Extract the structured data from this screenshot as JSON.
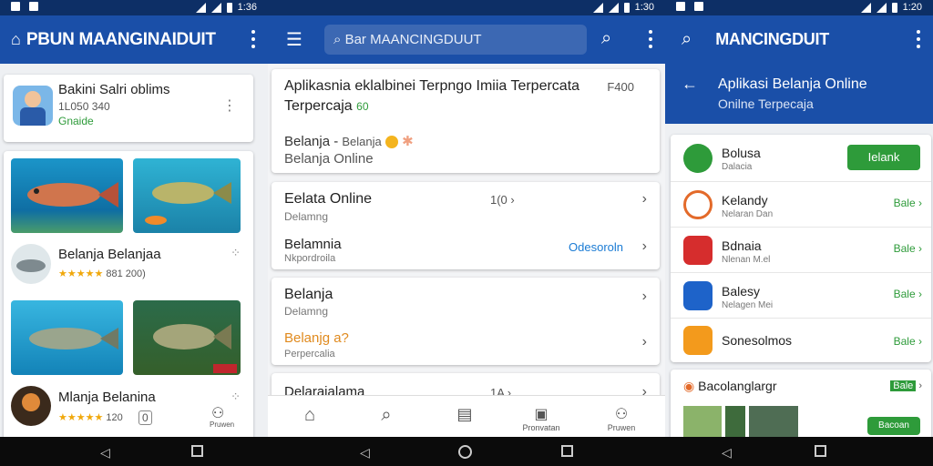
{
  "status": {
    "time_1": "1:36",
    "time_2": "1:30",
    "time_3": "1:20"
  },
  "panel1": {
    "title": "PBUN MAANGINAIDUIT",
    "profile": {
      "name": "Bakini Salri oblims",
      "id": "1L050 340",
      "tag": "Gnaide"
    },
    "list": [
      {
        "title": "Belanja Belanjaa",
        "rating": "★★★★★",
        "count": "881 200)"
      },
      {
        "title": "Mlanja Belanina",
        "rating": "★★★★★",
        "count": "120"
      }
    ],
    "bottom_badge": "0",
    "bottom_label": "Pruwen"
  },
  "panel2": {
    "search_text": "Bar MAANCINGDUUT",
    "header_card": {
      "title_line1": "Aplikasnia eklalbinei Terpngo Imiia Terpercata",
      "title_line2": "Terpercaja",
      "badge_right": "F400",
      "tag": "60",
      "sub1": "Belanja",
      "sub1b": "Belanja",
      "sub2": "Belanja Online"
    },
    "card_a": {
      "row1_title": "Eelata Online",
      "row1_sub": "Delamng",
      "row1_right": "1(0",
      "row2_title": "Belamnia",
      "row2_sub": "Nkpordroila",
      "row2_link": "Odesoroln"
    },
    "card_b": {
      "row1_title": "Belanja",
      "row1_sub": "Delamng",
      "row2_title": "Belanjg a?",
      "row2_sub": "Perpercalia"
    },
    "card_c": {
      "row1_title": "Delaraialama",
      "row1_right": "1A"
    },
    "bottom_nav": [
      "",
      "",
      "",
      "Pronvatan",
      "Pruwen"
    ]
  },
  "panel3": {
    "title": "MANCINGDUIT",
    "header_line1": "Aplikasi Belanja Online",
    "header_line2": "Onilne Terpecaja",
    "apps": [
      {
        "name": "Bolusa",
        "sub": "Dalacia",
        "action": "Ielank",
        "color": "#2e9b3a"
      },
      {
        "name": "Kelandy",
        "sub": "Nelaran Dan",
        "action": "Bale",
        "color": "#e36a2a"
      },
      {
        "name": "Bdnaia",
        "sub": "Nlenan M.el",
        "action": "Bale",
        "color": "#d62d2d"
      },
      {
        "name": "Balesy",
        "sub": "Nelagen Mei",
        "action": "Bale",
        "color": "#1e63c9"
      },
      {
        "name": "Sonesolmos",
        "sub": "",
        "action": "Bale",
        "color": "#f39a1c"
      }
    ],
    "footer": {
      "title": "Bacolanglargr",
      "badge": "Bale",
      "button": "Bacoan"
    }
  },
  "colors": {
    "primary": "#1a4fa8",
    "status": "#0d2f66",
    "green": "#2e9b3a",
    "link": "#1a7bd4",
    "orange": "#e08a1e"
  }
}
